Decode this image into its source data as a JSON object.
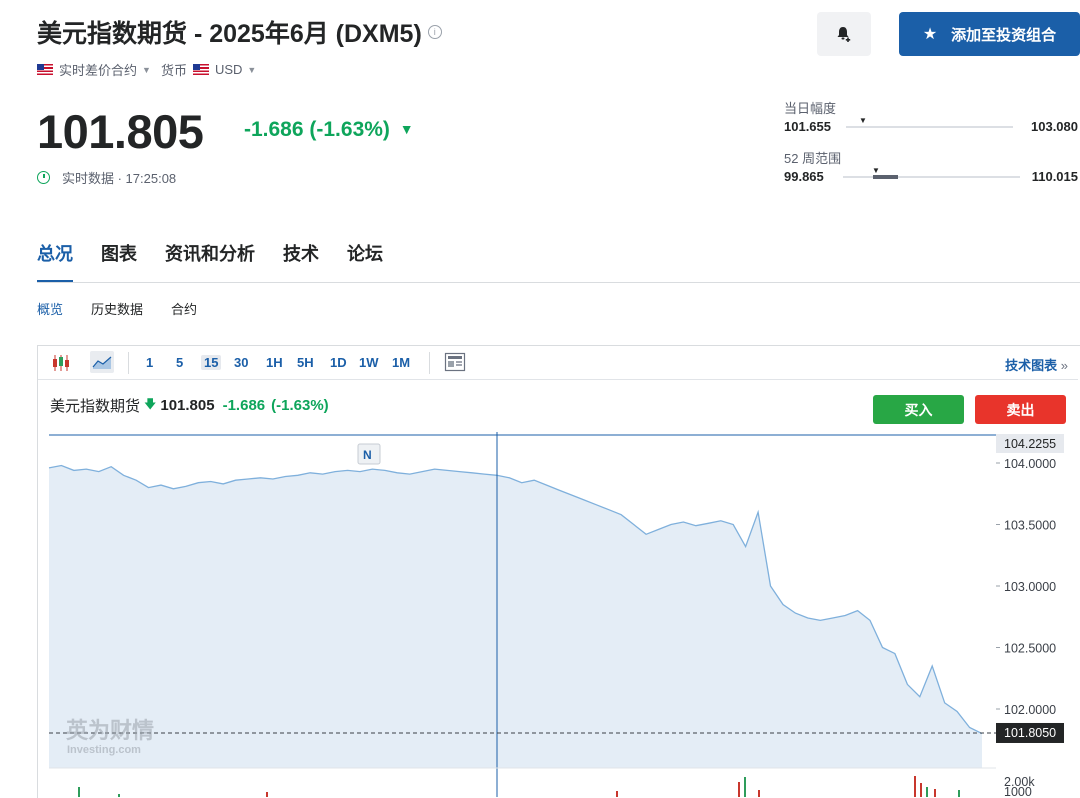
{
  "header": {
    "title": "美元指数期货 - 2025年6月 (DXM5)",
    "contract_type": "实时差价合约",
    "currency_label": "货币",
    "currency": "USD",
    "add_button": "添加至投资组合"
  },
  "quote": {
    "price": "101.805",
    "change": "-1.686",
    "change_pct": "(-1.63%)",
    "realtime_label": "实时数据 · 17:25:08"
  },
  "ranges": {
    "day": {
      "label": "当日幅度",
      "low": "101.655",
      "high": "103.080"
    },
    "week52": {
      "label": "52 周范围",
      "low": "99.865",
      "high": "110.015"
    }
  },
  "tabs": [
    "总况",
    "图表",
    "资讯和分析",
    "技术",
    "论坛"
  ],
  "subtabs": [
    "概览",
    "历史数据",
    "合约"
  ],
  "chart_toolbar": {
    "intervals": [
      "1",
      "5",
      "15",
      "30",
      "1H",
      "5H",
      "1D",
      "1W",
      "1M"
    ],
    "selected_interval": "15",
    "tech_chart_link": "技术图表",
    "link_arrow": "»"
  },
  "chart_legend": {
    "name": "美元指数期货",
    "price": "101.805",
    "change": "-1.686",
    "change_pct": "(-1.63%)"
  },
  "trade_buttons": {
    "buy": "买入",
    "sell": "卖出"
  },
  "watermark": {
    "cn": "英为财情",
    "en": "Investing.com"
  },
  "news_marker": "N",
  "colors": {
    "accent": "#1b5fa8",
    "down": "#0ea55b",
    "buy": "#28a745",
    "sell": "#e8342b",
    "line": "#7fb0dc",
    "area": "#e4edf6"
  },
  "chart_data": {
    "type": "area",
    "y_ticks": [
      "104.0000",
      "103.5000",
      "103.0000",
      "102.5000",
      "102.0000"
    ],
    "ylim": [
      101.8,
      104.23
    ],
    "crosshair_price": "104.2255",
    "last_price": "101.8050",
    "volume_ticks": [
      "2.00k",
      "1000"
    ],
    "values": [
      103.96,
      103.98,
      103.94,
      103.95,
      103.93,
      103.97,
      103.9,
      103.86,
      103.8,
      103.82,
      103.79,
      103.81,
      103.84,
      103.85,
      103.83,
      103.86,
      103.87,
      103.88,
      103.87,
      103.89,
      103.9,
      103.92,
      103.91,
      103.93,
      103.94,
      103.93,
      103.95,
      103.94,
      103.92,
      103.91,
      103.93,
      103.95,
      103.94,
      103.93,
      103.92,
      103.91,
      103.9,
      103.88,
      103.84,
      103.86,
      103.82,
      103.78,
      103.74,
      103.7,
      103.66,
      103.62,
      103.58,
      103.5,
      103.42,
      103.46,
      103.5,
      103.52,
      103.49,
      103.51,
      103.53,
      103.5,
      103.32,
      103.6,
      103.0,
      102.85,
      102.78,
      102.74,
      102.72,
      102.74,
      102.76,
      102.8,
      102.72,
      102.5,
      102.45,
      102.2,
      102.1,
      102.35,
      102.05,
      101.98,
      101.85,
      101.8
    ]
  }
}
